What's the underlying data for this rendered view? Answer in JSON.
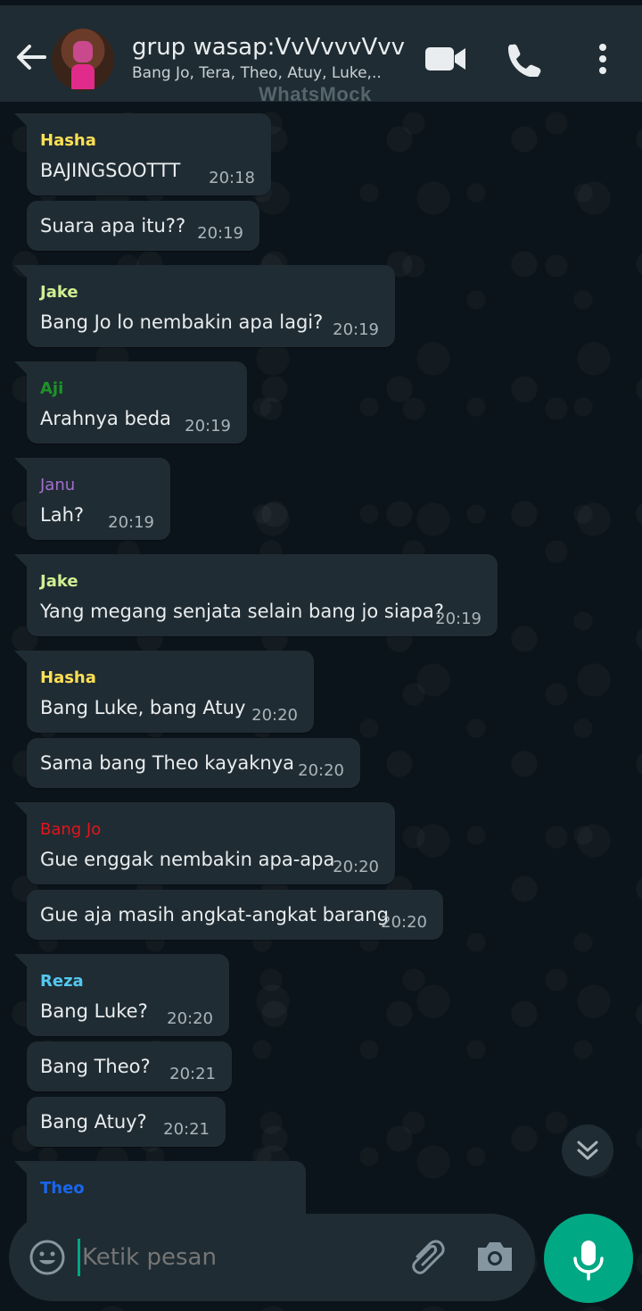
{
  "header": {
    "title": "grup wasap:VvVvvvVvv",
    "subtitle": "Bang Jo, Tera, Theo, Atuy, Luke,..",
    "watermark": "WhatsMock",
    "icons": [
      "back-arrow-icon",
      "video-call-icon",
      "voice-call-icon",
      "more-options-icon"
    ]
  },
  "colors": {
    "header_bg": "#1f2c33",
    "chat_bg": "#0b141a",
    "bubble_bg": "#202c33",
    "accent": "#00a884",
    "hasha": "#ffe054",
    "jake": "#d0ef93",
    "aji": "#1c9427",
    "janu": "#a36fd0",
    "bang_jo": "#e5141b",
    "reza": "#53c8f0",
    "theo": "#1866ec"
  },
  "messages": [
    {
      "sender": "Hasha",
      "text": "BAJINGSOOTTT",
      "time": "20:18"
    },
    {
      "sender": "",
      "text": "Suara apa itu??",
      "time": "20:19"
    },
    {
      "sender": "Jake",
      "text": "Bang Jo lo nembakin apa lagi?",
      "time": "20:19"
    },
    {
      "sender": "Aji",
      "text": "Arahnya beda",
      "time": "20:19"
    },
    {
      "sender": "Janu",
      "text": "Lah?",
      "time": "20:19"
    },
    {
      "sender": "Jake",
      "text": "Yang megang senjata selain bang jo siapa?",
      "time": "20:19"
    },
    {
      "sender": "Hasha",
      "text": "Bang Luke, bang Atuy",
      "time": "20:20"
    },
    {
      "sender": "",
      "text": "Sama bang Theo kayaknya",
      "time": "20:20"
    },
    {
      "sender": "Bang Jo",
      "text": "Gue enggak nembakin apa-apa",
      "time": "20:20"
    },
    {
      "sender": "",
      "text": "Gue aja masih angkat-angkat barang",
      "time": "20:20"
    },
    {
      "sender": "Reza",
      "text": "Bang Luke?",
      "time": "20:20"
    },
    {
      "sender": "",
      "text": "Bang Theo?",
      "time": "20:21"
    },
    {
      "sender": "",
      "text": "Bang Atuy?",
      "time": "20:21"
    },
    {
      "sender": "Theo",
      "text": "",
      "time": ""
    }
  ],
  "composer": {
    "placeholder": "Ketik pesan",
    "icons": [
      "emoji-icon",
      "attach-icon",
      "camera-icon",
      "microphone-icon",
      "scroll-down-icon"
    ]
  }
}
